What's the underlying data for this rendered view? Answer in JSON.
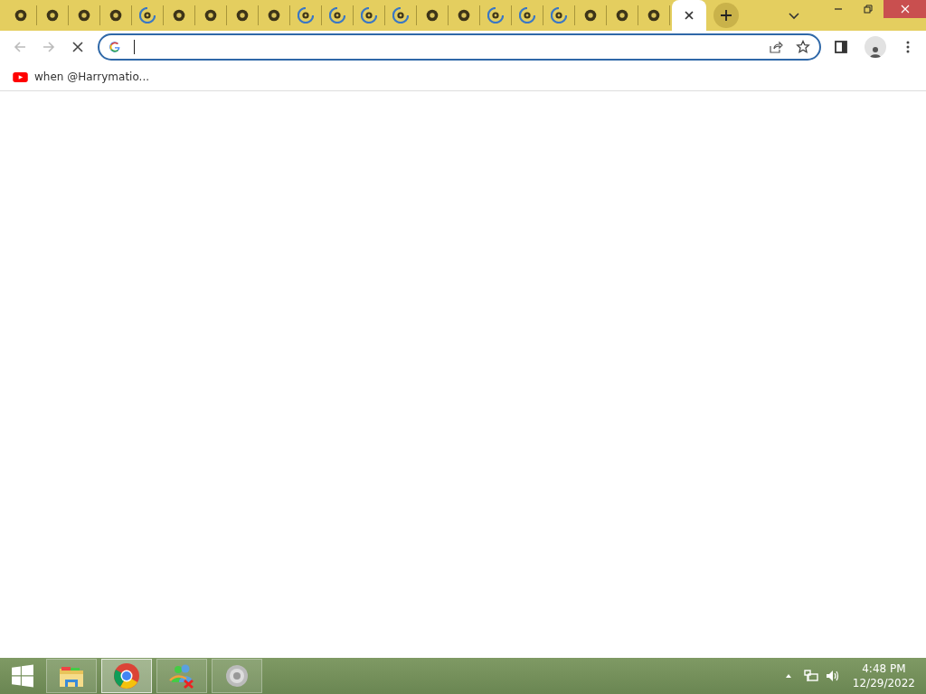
{
  "tabs": [
    {
      "selected": false,
      "loading": false
    },
    {
      "selected": false,
      "loading": false
    },
    {
      "selected": false,
      "loading": false
    },
    {
      "selected": false,
      "loading": false
    },
    {
      "selected": false,
      "loading": true
    },
    {
      "selected": false,
      "loading": false
    },
    {
      "selected": false,
      "loading": false
    },
    {
      "selected": false,
      "loading": false
    },
    {
      "selected": false,
      "loading": false
    },
    {
      "selected": false,
      "loading": true
    },
    {
      "selected": false,
      "loading": true
    },
    {
      "selected": false,
      "loading": true
    },
    {
      "selected": false,
      "loading": true
    },
    {
      "selected": false,
      "loading": false
    },
    {
      "selected": false,
      "loading": false
    },
    {
      "selected": false,
      "loading": true
    },
    {
      "selected": false,
      "loading": true
    },
    {
      "selected": false,
      "loading": true
    },
    {
      "selected": false,
      "loading": false
    },
    {
      "selected": false,
      "loading": false
    },
    {
      "selected": false,
      "loading": false
    },
    {
      "selected": true
    }
  ],
  "bookmarks": [
    {
      "label": "when @Harrymatio..."
    }
  ],
  "taskbar": {
    "apps": [
      {
        "kind": "explorer",
        "selected": false
      },
      {
        "kind": "chrome",
        "selected": true
      },
      {
        "kind": "messenger",
        "selected": false
      },
      {
        "kind": "speaker",
        "selected": false
      }
    ],
    "time": "4:48 PM",
    "date": "12/29/2022"
  }
}
